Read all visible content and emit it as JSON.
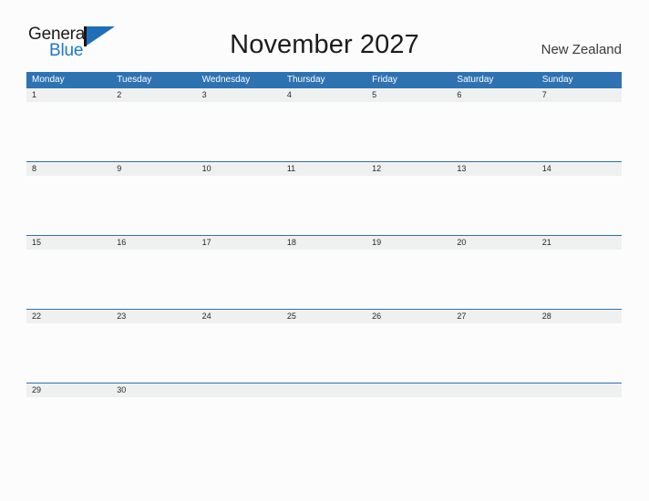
{
  "brand": {
    "name_part1": "General",
    "name_part2": "Blue",
    "flag_icon": "blue-flag-triangle-icon"
  },
  "header": {
    "title": "November 2027",
    "country": "New Zealand"
  },
  "colors": {
    "header_blue": "#2e72b2",
    "date_band_gray": "#eff0f0",
    "page_background": "#fcfcfc",
    "brand_blue": "#1f78c8",
    "title_text": "#1c1c1c"
  },
  "calendar": {
    "weekdays": [
      "Monday",
      "Tuesday",
      "Wednesday",
      "Thursday",
      "Friday",
      "Saturday",
      "Sunday"
    ],
    "weeks": [
      {
        "days": [
          "1",
          "2",
          "3",
          "4",
          "5",
          "6",
          "7"
        ]
      },
      {
        "days": [
          "8",
          "9",
          "10",
          "11",
          "12",
          "13",
          "14"
        ]
      },
      {
        "days": [
          "15",
          "16",
          "17",
          "18",
          "19",
          "20",
          "21"
        ]
      },
      {
        "days": [
          "22",
          "23",
          "24",
          "25",
          "26",
          "27",
          "28"
        ]
      },
      {
        "days": [
          "29",
          "30",
          "",
          "",
          "",
          "",
          ""
        ]
      }
    ]
  }
}
